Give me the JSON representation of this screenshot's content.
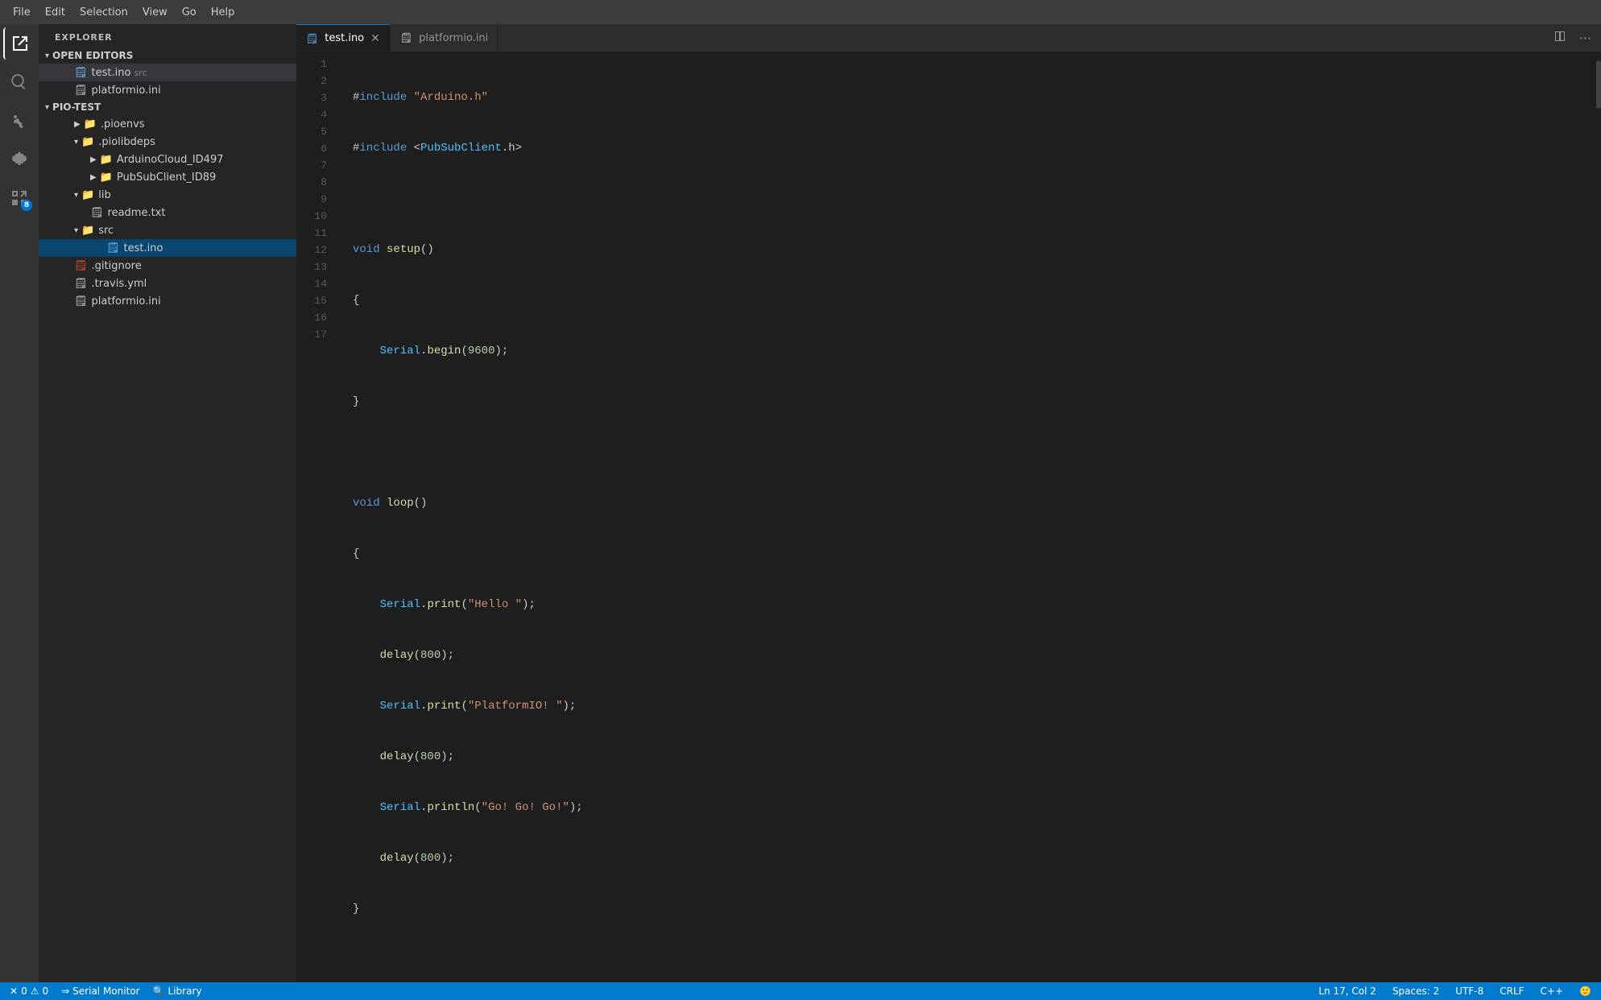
{
  "menubar": {
    "items": [
      "File",
      "Edit",
      "Selection",
      "View",
      "Go",
      "Help"
    ]
  },
  "activity": {
    "icons": [
      {
        "name": "explorer-icon",
        "symbol": "⎘",
        "active": true,
        "badge": null
      },
      {
        "name": "search-icon",
        "symbol": "🔍",
        "active": false,
        "badge": null
      },
      {
        "name": "git-icon",
        "symbol": "⑂",
        "active": false,
        "badge": null
      },
      {
        "name": "extensions-icon",
        "symbol": "⊞",
        "active": false,
        "badge": "8"
      }
    ]
  },
  "sidebar": {
    "header": "EXPLORER",
    "sections": {
      "open_editors": {
        "label": "OPEN EDITORS",
        "items": [
          {
            "name": "test.ino",
            "tag": "src",
            "indent": 2,
            "active": true
          },
          {
            "name": "platformio.ini",
            "indent": 2,
            "active": false
          }
        ]
      },
      "pio_test": {
        "label": "PIO-TEST",
        "items": [
          {
            "name": ".pioenvs",
            "type": "folder",
            "indent": 2
          },
          {
            "name": ".piolibdeps",
            "type": "folder",
            "indent": 2
          },
          {
            "name": "ArduinoCloud_ID497",
            "type": "subfolder",
            "indent": 3
          },
          {
            "name": "PubSubClient_ID89",
            "type": "subfolder",
            "indent": 3
          },
          {
            "name": "lib",
            "type": "folder-special",
            "indent": 2
          },
          {
            "name": "readme.txt",
            "type": "file",
            "indent": 3
          },
          {
            "name": "src",
            "type": "folder-special",
            "indent": 2
          },
          {
            "name": "test.ino",
            "type": "ino",
            "indent": 4,
            "active": true
          },
          {
            "name": ".gitignore",
            "type": "gitignore",
            "indent": 2
          },
          {
            "name": ".travis.yml",
            "type": "travis",
            "indent": 2
          },
          {
            "name": "platformio.ini",
            "type": "ini",
            "indent": 2
          }
        ]
      }
    }
  },
  "tabs": {
    "active": "test.ino",
    "items": [
      {
        "label": "test.ino",
        "type": "ino",
        "active": true,
        "closable": true
      },
      {
        "label": "platformio.ini",
        "type": "ini",
        "active": false,
        "closable": false
      }
    ]
  },
  "code": {
    "lines": [
      {
        "n": 1,
        "text": "#include \"Arduino.h\""
      },
      {
        "n": 2,
        "text": "#include <PubSubClient.h>"
      },
      {
        "n": 3,
        "text": ""
      },
      {
        "n": 4,
        "text": "void setup()"
      },
      {
        "n": 5,
        "text": "{"
      },
      {
        "n": 6,
        "text": "    Serial.begin(9600);"
      },
      {
        "n": 7,
        "text": "}"
      },
      {
        "n": 8,
        "text": ""
      },
      {
        "n": 9,
        "text": "void loop()"
      },
      {
        "n": 10,
        "text": "{"
      },
      {
        "n": 11,
        "text": "    Serial.print(\"Hello \");"
      },
      {
        "n": 12,
        "text": "    delay(800);"
      },
      {
        "n": 13,
        "text": "    Serial.print(\"PlatformIO! \");"
      },
      {
        "n": 14,
        "text": "    delay(800);"
      },
      {
        "n": 15,
        "text": "    Serial.println(\"Go! Go! Go!\");"
      },
      {
        "n": 16,
        "text": "    delay(800);"
      },
      {
        "n": 17,
        "text": "}"
      }
    ]
  },
  "statusbar": {
    "left": {
      "errors": "0",
      "warnings": "0",
      "serial_monitor": "Serial Monitor",
      "library": "Library"
    },
    "right": {
      "position": "Ln 17, Col 2",
      "spaces": "Spaces: 2",
      "encoding": "UTF-8",
      "line_ending": "CRLF",
      "language": "C++"
    }
  }
}
